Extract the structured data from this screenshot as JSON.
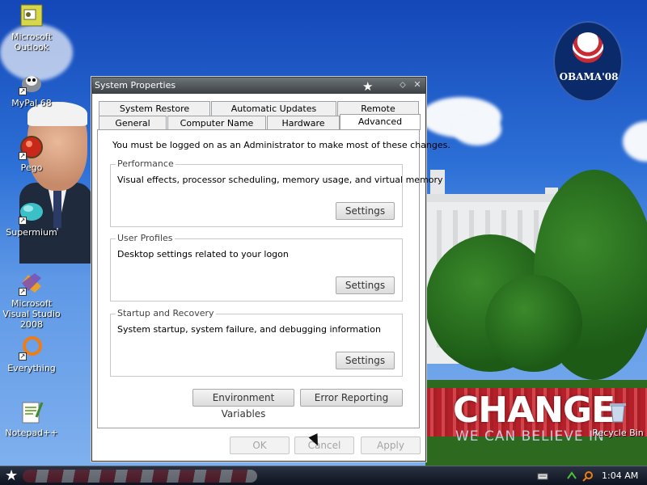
{
  "desktop": {
    "icons": [
      {
        "label": "Microsoft Outlook",
        "icon": "outlook-icon"
      },
      {
        "label": "MyPal 68",
        "icon": "mypal-icon"
      },
      {
        "label": "Pego",
        "icon": "pego-icon"
      },
      {
        "label": "Supermium",
        "icon": "supermium-icon"
      },
      {
        "label": "Microsoft Visual Studio 2008",
        "icon": "visual-studio-icon"
      },
      {
        "label": "Everything",
        "icon": "everything-icon"
      },
      {
        "label": "Notepad++",
        "icon": "notepadpp-icon"
      },
      {
        "label": "Recycle Bin",
        "icon": "recycle-bin-icon"
      }
    ],
    "wallpaper": {
      "logo_word": "OBAMA'08",
      "slogan": "CHANGE",
      "subslogan": "WE CAN BELIEVE IN"
    }
  },
  "window": {
    "title": "System Properties",
    "tabs_row1": [
      "System Restore",
      "Automatic Updates",
      "Remote"
    ],
    "tabs_row2": [
      "General",
      "Computer Name",
      "Hardware",
      "Advanced"
    ],
    "active_tab": "Advanced",
    "admin_note": "You must be logged on as an Administrator to make most of these changes.",
    "performance": {
      "legend": "Performance",
      "description": "Visual effects, processor scheduling, memory usage, and virtual memory",
      "button": "Settings"
    },
    "user_profiles": {
      "legend": "User Profiles",
      "description": "Desktop settings related to your logon",
      "button": "Settings"
    },
    "startup_recovery": {
      "legend": "Startup and Recovery",
      "description": "System startup, system failure, and debugging information",
      "button": "Settings"
    },
    "environment_variables": "Environment Variables",
    "error_reporting": "Error Reporting",
    "ok": "OK",
    "cancel": "Cancel",
    "apply": "Apply"
  },
  "taskbar": {
    "clock": "1:04 AM"
  },
  "colors": {
    "titlebar": "#4a5053",
    "dialog_bg": "#ffffff",
    "accent_red": "#b21f2a"
  }
}
